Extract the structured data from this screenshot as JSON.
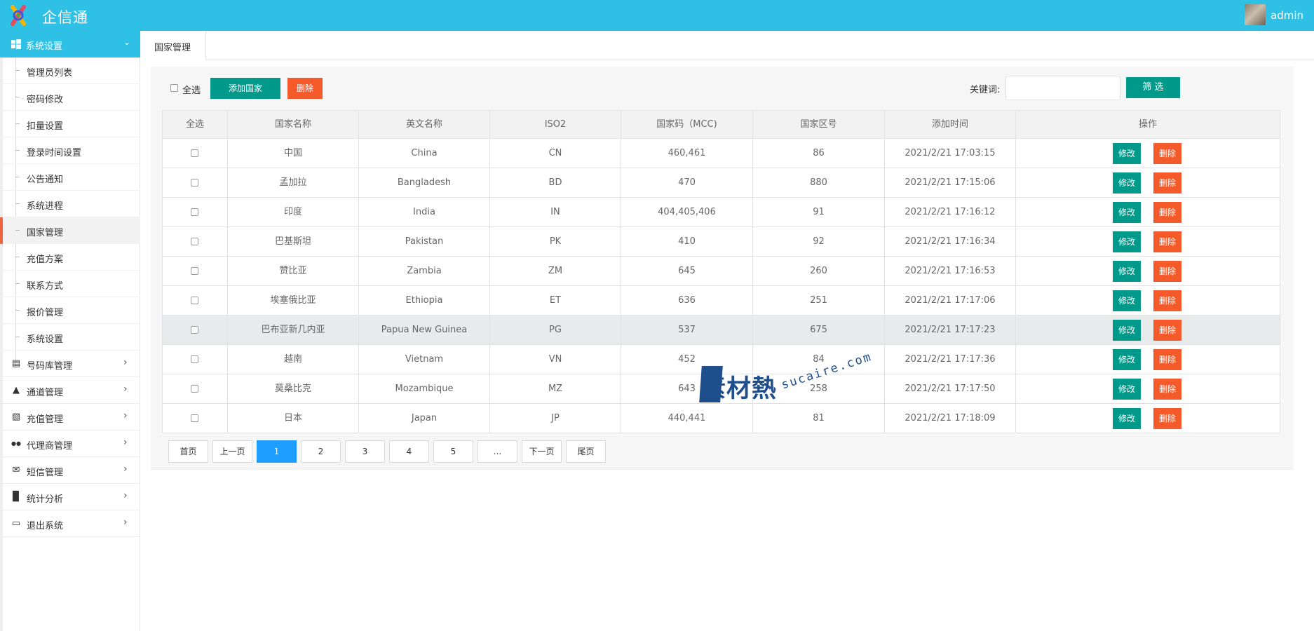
{
  "header": {
    "app_title": "企信通",
    "user_name": "admin"
  },
  "sidebar": {
    "active_group": "系统设置",
    "sub_items": [
      "管理员列表",
      "密码修改",
      "扣量设置",
      "登录时间设置",
      "公告通知",
      "系统进程",
      "国家管理",
      "充值方案",
      "联系方式",
      "报价管理",
      "系统设置"
    ],
    "current_sub": "国家管理",
    "groups": [
      {
        "label": "号码库管理",
        "icon": "database-icon"
      },
      {
        "label": "通道管理",
        "icon": "sitemap-icon"
      },
      {
        "label": "充值管理",
        "icon": "credit-card-icon"
      },
      {
        "label": "代理商管理",
        "icon": "users-icon"
      },
      {
        "label": "短信管理",
        "icon": "envelope-icon"
      },
      {
        "label": "统计分析",
        "icon": "bar-chart-icon"
      },
      {
        "label": "退出系统",
        "icon": "monitor-icon"
      }
    ]
  },
  "tabs": [
    {
      "label": "国家管理"
    }
  ],
  "toolbar": {
    "select_all": "全选",
    "add_button": "添加国家",
    "delete_button": "删除",
    "keyword_label": "关键词:",
    "keyword_value": "",
    "filter_button": "筛 选"
  },
  "table": {
    "columns": [
      "全选",
      "国家名称",
      "英文名称",
      "ISO2",
      "国家码（MCC)",
      "国家区号",
      "添加时间",
      "操作"
    ],
    "edit_label": "修改",
    "delete_label": "删除",
    "rows": [
      {
        "name": "中国",
        "en": "China",
        "iso2": "CN",
        "mcc": "460,461",
        "code": "86",
        "time": "2021/2/21 17:03:15"
      },
      {
        "name": "孟加拉",
        "en": "Bangladesh",
        "iso2": "BD",
        "mcc": "470",
        "code": "880",
        "time": "2021/2/21 17:15:06"
      },
      {
        "name": "印度",
        "en": "India",
        "iso2": "IN",
        "mcc": "404,405,406",
        "code": "91",
        "time": "2021/2/21 17:16:12"
      },
      {
        "name": "巴基斯坦",
        "en": "Pakistan",
        "iso2": "PK",
        "mcc": "410",
        "code": "92",
        "time": "2021/2/21 17:16:34"
      },
      {
        "name": "赞比亚",
        "en": "Zambia",
        "iso2": "ZM",
        "mcc": "645",
        "code": "260",
        "time": "2021/2/21 17:16:53"
      },
      {
        "name": "埃塞俄比亚",
        "en": "Ethiopia",
        "iso2": "ET",
        "mcc": "636",
        "code": "251",
        "time": "2021/2/21 17:17:06"
      },
      {
        "name": "巴布亚新几内亚",
        "en": "Papua New Guinea",
        "iso2": "PG",
        "mcc": "537",
        "code": "675",
        "time": "2021/2/21 17:17:23"
      },
      {
        "name": "越南",
        "en": "Vietnam",
        "iso2": "VN",
        "mcc": "452",
        "code": "84",
        "time": "2021/2/21 17:17:36"
      },
      {
        "name": "莫桑比克",
        "en": "Mozambique",
        "iso2": "MZ",
        "mcc": "643",
        "code": "258",
        "time": "2021/2/21 17:17:50"
      },
      {
        "name": "日本",
        "en": "Japan",
        "iso2": "JP",
        "mcc": "440,441",
        "code": "81",
        "time": "2021/2/21 17:18:09"
      }
    ],
    "highlight_row": 6
  },
  "pager": {
    "items": [
      "首页",
      "上一页",
      "1",
      "2",
      "3",
      "4",
      "5",
      "...",
      "下一页",
      "尾页"
    ],
    "active": "1"
  },
  "watermark": {
    "main": "素材熱",
    "sub": "sucaire.com"
  },
  "colors": {
    "header": "#2fc0e6",
    "primary_button": "#00998a",
    "danger_button": "#f55a2b",
    "pager_active": "#1e9fff",
    "current_marker": "#f0643b"
  }
}
